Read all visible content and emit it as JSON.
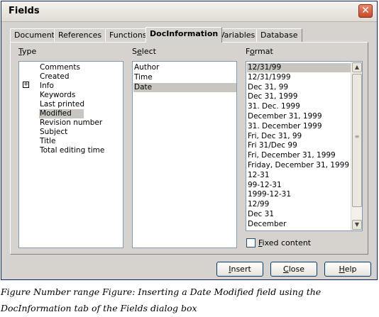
{
  "window": {
    "title": "Fields"
  },
  "tabs": [
    "Document",
    "References",
    "Functions",
    "DocInformation",
    "Variables",
    "Database"
  ],
  "type_section": {
    "label_hotkey": "T",
    "label_rest": "ype",
    "items": [
      "Comments",
      "Created",
      "Info",
      "Keywords",
      "Last printed",
      "Modified",
      "Revision number",
      "Subject",
      "Title",
      "Total editing time"
    ],
    "selected": "Modified",
    "expandable": "Info",
    "expander_symbol": "+"
  },
  "select_section": {
    "label_prefix": "S",
    "label_hotkey": "e",
    "label_rest": "lect",
    "items": [
      "Author",
      "Time",
      "Date"
    ],
    "selected": "Date"
  },
  "format_section": {
    "label_prefix": "F",
    "label_hotkey": "o",
    "label_rest": "rmat",
    "items": [
      "12/31/99",
      "12/31/1999",
      "Dec 31, 99",
      "Dec 31, 1999",
      "31. Dec. 1999",
      "December 31, 1999",
      "31. December 1999",
      "Fri, Dec 31, 99",
      "Fri 31/Dec 99",
      "Fri, December 31, 1999",
      "Friday, December 31, 1999",
      "12-31",
      "99-12-31",
      "1999-12-31",
      "12/99",
      "Dec 31",
      "December"
    ],
    "selected": "12/31/99"
  },
  "fixed_content": {
    "hotkey": "F",
    "rest": "ixed content",
    "checked": false
  },
  "buttons": {
    "insert": {
      "hotkey": "I",
      "rest": "nsert"
    },
    "close": {
      "hotkey": "C",
      "rest": "lose"
    },
    "help": {
      "hotkey": "H",
      "rest": "elp"
    }
  },
  "caption": {
    "line1": "Figure Number range Figure: Inserting a Date Modified field using the",
    "line2": "DocInformation tab of the Fields dialog box"
  },
  "icons": {
    "close": "close-icon",
    "scroll_up": "up-arrow-icon",
    "scroll_down": "down-arrow-icon",
    "expand": "plus-expander-icon"
  }
}
